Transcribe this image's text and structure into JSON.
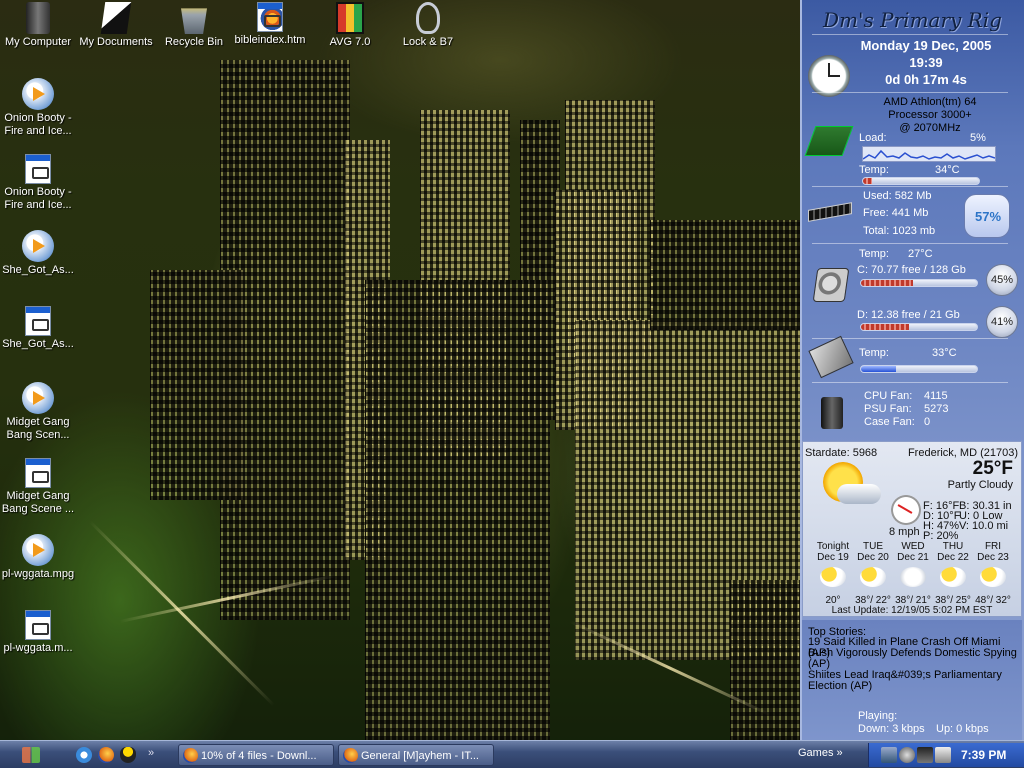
{
  "desktop_icons": [
    {
      "label": "My Computer",
      "icon": "computer-icon"
    },
    {
      "label": "My Documents",
      "icon": "documents-icon"
    },
    {
      "label": "Recycle Bin",
      "icon": "recycle-bin-icon"
    },
    {
      "label": "bibleindex.htm",
      "icon": "firefox-document-icon"
    },
    {
      "label": "AVG 7.0",
      "icon": "avg-icon"
    },
    {
      "label": "Lock & B7",
      "icon": "keys-icon"
    },
    {
      "label": "Onion Booty - Fire and Ice...",
      "icon": "media-player-icon"
    },
    {
      "label": "Onion Booty - Fire and Ice...",
      "icon": "video-file-icon"
    },
    {
      "label": "She_Got_As...",
      "icon": "media-player-icon"
    },
    {
      "label": "She_Got_As...",
      "icon": "video-file-icon"
    },
    {
      "label": "Midget Gang Bang Scen...",
      "icon": "media-player-icon"
    },
    {
      "label": "Midget Gang Bang Scene ...",
      "icon": "video-file-icon"
    },
    {
      "label": "pl-wggata.mpg",
      "icon": "media-player-icon"
    },
    {
      "label": "pl-wggata.m...",
      "icon": "video-file-icon"
    }
  ],
  "sysinfo": {
    "title": "Dm's Primary Rig",
    "date": "Monday 19 Dec, 2005",
    "time": "19:39",
    "uptime": "0d 0h 17m 4s",
    "cpu_line1": "AMD Athlon(tm) 64",
    "cpu_line2": "Processor 3000+",
    "cpu_line3": "@  2070MHz",
    "load_label": "Load:",
    "load_value": "5%",
    "cpu_temp_label": "Temp:",
    "cpu_temp": "34°C",
    "mem_used": "Used: 582 Mb",
    "mem_free": "Free:  441 Mb",
    "mem_total": "Total: 1023 mb",
    "mem_pct": "57%",
    "hdd_temp_label": "Temp:",
    "hdd_temp": "27°C",
    "drive_c": "C: 70.77 free / 128 Gb",
    "drive_c_pct": "45%",
    "drive_c_used": 0.45,
    "drive_d": "D: 12.38 free / 21 Gb",
    "drive_d_pct": "41%",
    "drive_d_used": 0.41,
    "mb_temp_label": "Temp:",
    "mb_temp": "33°C",
    "cpu_fan_label": "CPU Fan:",
    "cpu_fan": "4115",
    "psu_fan_label": "PSU Fan:",
    "psu_fan": "5273",
    "case_fan_label": "Case Fan:",
    "case_fan": "0"
  },
  "weather": {
    "stardate": "Stardate: 5968",
    "location": "Frederick, MD (21703)",
    "temp": "25°F",
    "condition": "Partly Cloudy",
    "wind": "8 mph",
    "feels": "F: 16°F",
    "humidity_line": "H: 47%",
    "dew": "D: 10°F",
    "precip": "P: 20%",
    "baro": "B: 30.31 in",
    "uv": "U: 0 Low",
    "visibility": "V: 10.0 mi",
    "forecast": [
      {
        "day": "Tonight",
        "date": "Dec 19",
        "temps": "20°"
      },
      {
        "day": "TUE",
        "date": "Dec 20",
        "temps": "38°/ 22°"
      },
      {
        "day": "WED",
        "date": "Dec 21",
        "temps": "38°/ 21°"
      },
      {
        "day": "THU",
        "date": "Dec 22",
        "temps": "38°/ 25°"
      },
      {
        "day": "FRI",
        "date": "Dec 23",
        "temps": "48°/ 32°"
      }
    ],
    "last_update": "Last Update: 12/19/05 5:02 PM EST"
  },
  "news": {
    "header": "Top Stories:",
    "items": [
      "19 Said Killed in Plane Crash Off Miami (AP)",
      "Bush Vigorously Defends Domestic Spying (AP)",
      "Shiites Lead Iraq&#039;s Parliamentary Election (AP)"
    ]
  },
  "net": {
    "playing": "Playing:",
    "down": "Down: 3 kbps",
    "up": "Up: 0 kbps"
  },
  "taskbar": {
    "tasks": [
      {
        "label": "10% of 4 files - Downl...",
        "icon": "firefox-icon"
      },
      {
        "label": "General [M]ayhem - IT...",
        "icon": "firefox-icon"
      }
    ],
    "toolbar_label": "Games",
    "clock": "7:39 PM"
  }
}
